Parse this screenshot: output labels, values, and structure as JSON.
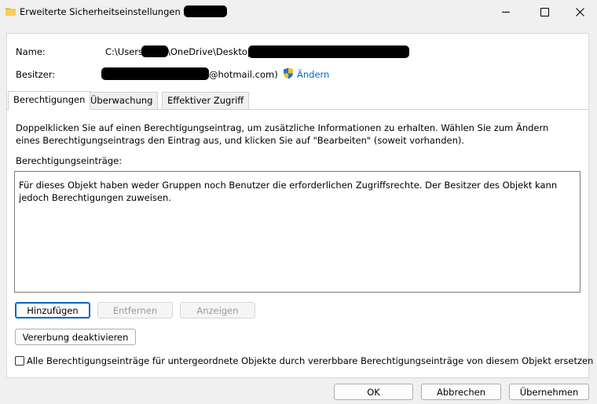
{
  "window": {
    "title": "Erweiterte Sicherheitseinstellungen für \"",
    "controls": {
      "minimize": "minimize-icon",
      "maximize": "maximize-icon",
      "close": "close-icon"
    }
  },
  "owner_info": {
    "name_label": "Name:",
    "name_prefix": "C:\\Users\\",
    "name_middle": "\\OneDrive\\Desktop\\",
    "owner_label": "Besitzer:",
    "owner_suffix": "@hotmail.com)",
    "change_link": "Ändern"
  },
  "tabs": [
    {
      "label": "Berechtigungen",
      "active": true
    },
    {
      "label": "Überwachung",
      "active": false
    },
    {
      "label": "Effektiver Zugriff",
      "active": false
    }
  ],
  "permissions": {
    "description": "Doppelklicken Sie auf einen Berechtigungseintrag, um zusätzliche Informationen zu erhalten. Wählen Sie zum Ändern eines Berechtigungseintrags den Eintrag aus, und klicken Sie auf \"Bearbeiten\" (soweit vorhanden).",
    "entries_label": "Berechtigungseinträge:",
    "entries_message": "Für dieses Objekt haben weder Gruppen noch Benutzer die erforderlichen Zugriffsrechte. Der Besitzer des Objekt kann jedoch Berechtigungen zuweisen.",
    "add_button": "Hinzufügen",
    "remove_button": "Entfernen",
    "view_button": "Anzeigen",
    "inheritance_button": "Vererbung deaktivieren",
    "replace_checkbox_label": "Alle Berechtigungseinträge für untergeordnete Objekte durch vererbbare Berechtigungseinträge von diesem Objekt ersetzen",
    "replace_checkbox_checked": false
  },
  "footer": {
    "ok_button": "OK",
    "cancel_button": "Abbrechen",
    "apply_button": "Übernehmen"
  },
  "colors": {
    "link": "#0066cc",
    "primary_border": "#0067c0",
    "window_bg": "#f0f0f0"
  }
}
